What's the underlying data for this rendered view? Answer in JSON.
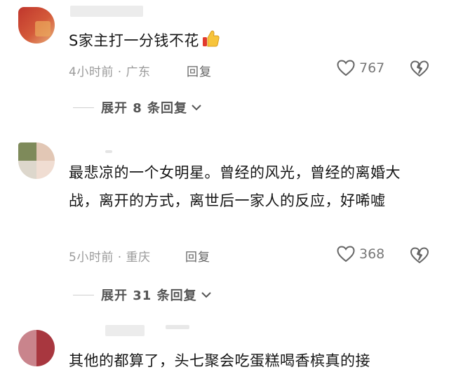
{
  "comments": [
    {
      "text": "S家主打一分钱不花",
      "emoji": "thumbs-up",
      "time_location": "4小时前 · 广东",
      "reply_label": "回复",
      "likes": "767",
      "expand_label": "展开 8 条回复"
    },
    {
      "text": "最悲凉的一个女明星。曾经的风光，曾经的离婚大战，离开的方式，离世后一家人的反应，好唏嘘",
      "time_location": "5小时前 · 重庆",
      "reply_label": "回复",
      "likes": "368",
      "expand_label": "展开 31 条回复"
    },
    {
      "text": "其他的都算了，头七聚会吃蛋糕喝香槟真的接"
    }
  ],
  "icons": {
    "like": "heart-outline-icon",
    "dislike": "broken-heart-icon",
    "expand": "chevron-down-icon"
  },
  "colors": {
    "text": "#161616",
    "meta": "#9a9a9a",
    "background": "#ffffff"
  }
}
